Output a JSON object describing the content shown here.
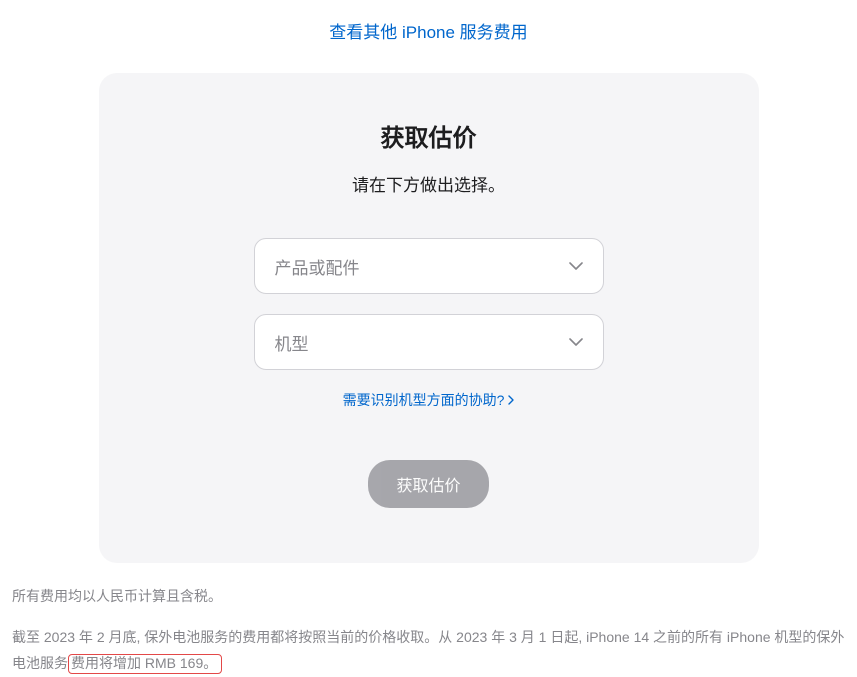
{
  "topLink": "查看其他 iPhone 服务费用",
  "panel": {
    "title": "获取估价",
    "subtitle": "请在下方做出选择。",
    "select1Placeholder": "产品或配件",
    "select2Placeholder": "机型",
    "helpLink": "需要识别机型方面的协助?",
    "submitLabel": "获取估价"
  },
  "footer": {
    "line1": "所有费用均以人民币计算且含税。",
    "line2Prefix": "截至 2023 年 2 月底, 保外电池服务的费用都将按照当前的价格收取。从 2023 年 3 月 1 日起, iPhone 14 之前的所有 iPhone 机型的保外电池服务",
    "line2Highlight": "费用将增加 RMB 169。"
  }
}
